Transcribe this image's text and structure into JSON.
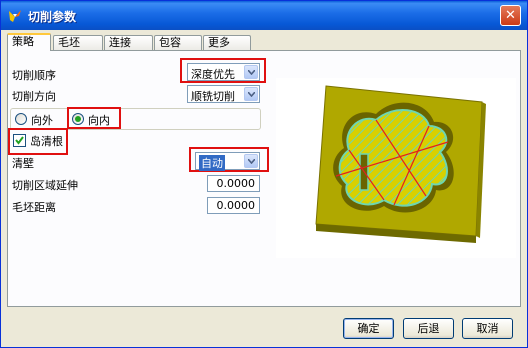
{
  "window": {
    "title": "切削参数",
    "close_symbol": "✕"
  },
  "tabs": [
    {
      "label": "策略",
      "active": true
    },
    {
      "label": "毛坯",
      "active": false
    },
    {
      "label": "连接",
      "active": false
    },
    {
      "label": "包容",
      "active": false
    },
    {
      "label": "更多",
      "active": false
    }
  ],
  "fields": {
    "cut_order": {
      "label": "切削顺序",
      "value": "深度优先"
    },
    "cut_direction": {
      "label": "切削方向",
      "value": "顺铣切削"
    },
    "pattern_direction": {
      "outward_label": "向外",
      "inward_label": "向内",
      "selected": "向内"
    },
    "island_cleanup": {
      "label": "岛清根",
      "checked": true
    },
    "wall_cleanup": {
      "label": "清壁",
      "value": "自动"
    },
    "cut_region_extension": {
      "label": "切削区域延伸",
      "value": "0.0000"
    },
    "blank_distance": {
      "label": "毛坯距离",
      "value": "0.0000"
    }
  },
  "buttons": {
    "ok": "确定",
    "back": "后退",
    "cancel": "取消"
  },
  "colors": {
    "accent_title": "#0758d6",
    "highlight_box": "#e01010",
    "preview_part": "#b0a800",
    "preview_hatch": "#6ed6b0",
    "preview_tool_path": "#e02020"
  },
  "icons": {
    "app": "app-logo-icon",
    "dropdown": "chevron-down-icon"
  }
}
